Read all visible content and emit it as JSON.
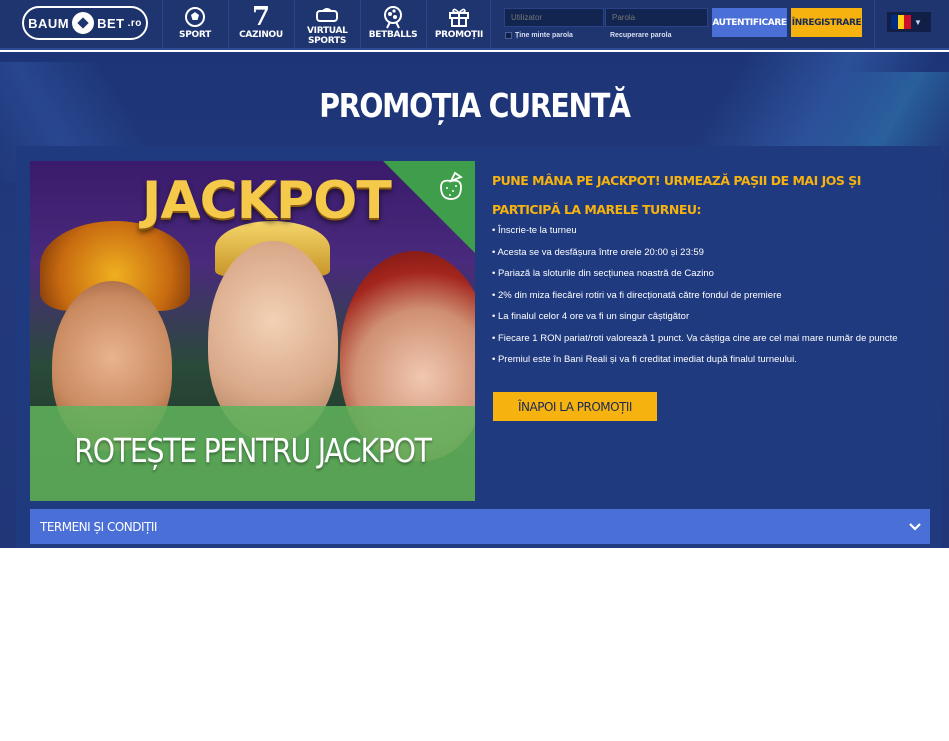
{
  "header": {
    "logo": {
      "part1": "BAUM",
      "part2": "BET",
      "suffix": ".ro"
    },
    "nav": [
      {
        "label": "SPORT",
        "icon": "soccer-ball-icon"
      },
      {
        "label": "CAZINOU",
        "icon": "seven-icon"
      },
      {
        "label": "VIRTUAL SPORTS",
        "icon": "vr-headset-icon"
      },
      {
        "label": "BETBALLS",
        "icon": "lottery-ball-machine-icon"
      },
      {
        "label": "PROMOȚII",
        "icon": "gift-icon"
      }
    ],
    "login": {
      "username_placeholder": "Utilizator",
      "password_placeholder": "Parola",
      "remember_label": "Ține minte parola",
      "recover_label": "Recuperare parola",
      "login_button": "AUTENTIFICARE",
      "register_button": "ÎNREGISTRARE"
    },
    "language": {
      "flag": "romania-flag-icon",
      "colors": [
        "#002b7f",
        "#fcd116",
        "#ce1126"
      ]
    }
  },
  "page": {
    "title": "PROMOȚIA CURENTĂ"
  },
  "promo": {
    "image": {
      "jackpot_text": "JACKPOT",
      "caption": "ROTEȘTE PENTRU JACKPOT",
      "corner_icon": "strawberry-slot-icon"
    },
    "heading": "PUNE MÂNA PE JACKPOT! URMEAZĂ PAȘII DE MAI JOS ȘI PARTICIPĂ LA MARELE TURNEU:",
    "rules": [
      "Înscrie-te la turneu",
      "Acesta se va desfășura între orele 20:00 și 23:59",
      "Pariază la sloturile din secțiunea noastră de Cazino",
      "2% din miza fiecărei rotiri va fi direcționată către fondul de premiere",
      "La finalul celor 4 ore va fi un singur câștigător",
      "Fiecare 1 RON pariat/roti valorează 1 punct. Va câștiga cine are cel mai mare număr de puncte",
      "Premiul este în Bani Reali și va fi creditat imediat după finalul turneului."
    ],
    "back_button": "ÎNAPOI LA PROMOȚII"
  },
  "terms": {
    "label": "TERMENI ȘI CONDIȚII",
    "icon": "chevron-down-icon"
  },
  "colors": {
    "header_bg": "#1f3570",
    "accent_blue": "#4a70d8",
    "accent_yellow": "#f6b20f",
    "panel_bg": "#1f3a7f"
  }
}
